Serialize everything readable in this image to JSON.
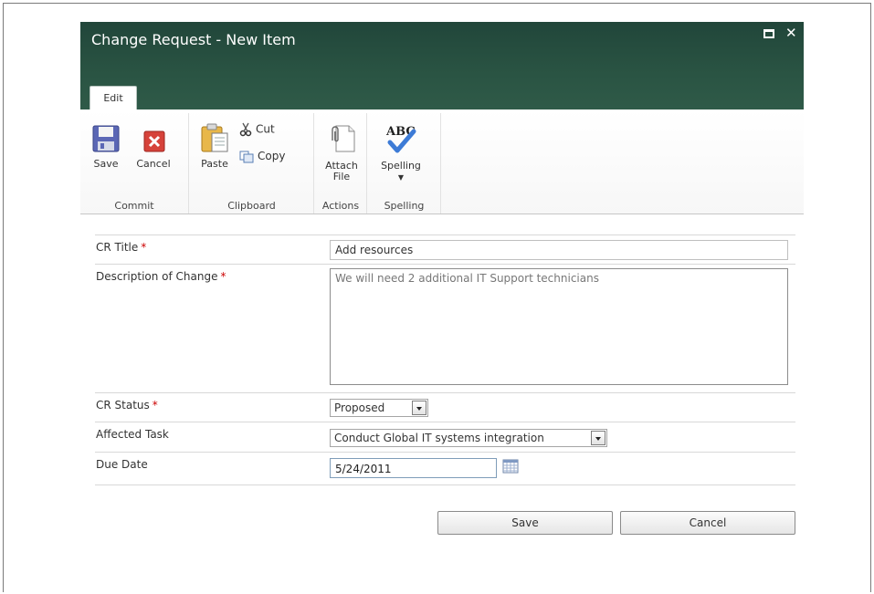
{
  "dialog": {
    "title": "Change Request - New Item"
  },
  "ribbon": {
    "tab_label": "Edit",
    "groups": {
      "commit": {
        "label": "Commit",
        "save": "Save",
        "cancel": "Cancel"
      },
      "clipboard": {
        "label": "Clipboard",
        "paste": "Paste",
        "cut": "Cut",
        "copy": "Copy"
      },
      "actions": {
        "label": "Actions",
        "attach_line1": "Attach",
        "attach_line2": "File"
      },
      "spelling": {
        "label": "Spelling",
        "spelling": "Spelling",
        "abc": "ABC"
      }
    }
  },
  "form": {
    "cr_title": {
      "label": "CR Title",
      "required": "*",
      "value": "Add resources"
    },
    "description": {
      "label": "Description of Change",
      "required": "*",
      "value": "We will need 2 additional IT Support technicians"
    },
    "cr_status": {
      "label": "CR Status",
      "required": "*",
      "value": "Proposed"
    },
    "affected_task": {
      "label": "Affected Task",
      "value": "Conduct Global IT systems integration"
    },
    "due_date": {
      "label": "Due Date",
      "value": "5/24/2011"
    }
  },
  "buttons": {
    "save": "Save",
    "cancel": "Cancel"
  },
  "colors": {
    "titlebar": "#2a5443",
    "required": "#cc0000"
  },
  "icons": {
    "save": "floppy-disk-icon",
    "cancel": "red-x-icon",
    "paste": "clipboard-icon",
    "cut": "scissors-icon",
    "copy": "copy-icon",
    "attach": "paperclip-icon",
    "spelling": "abc-check-icon",
    "calendar": "calendar-icon"
  }
}
